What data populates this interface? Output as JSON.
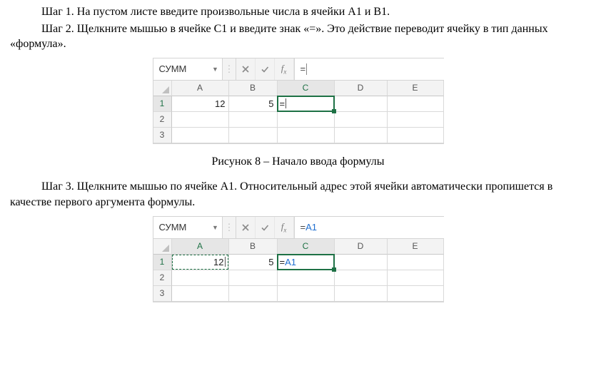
{
  "text": {
    "step1": "Шаг 1. На пустом листе введите произвольные числа в ячейки A1 и B1.",
    "step2": "Шаг 2. Щелкните мышью в ячейке C1 и введите знак «=». Это действие переводит ячейку в тип данных «формула».",
    "caption1": "Рисунок 8 – Начало ввода формулы",
    "step3": "Шаг 3. Щелкните мышью по ячейке A1. Относительный адрес этой ячейки автоматически пропишется в качестве первого аргумента формулы."
  },
  "shot1": {
    "name_box": "СУММ",
    "formula": "=",
    "columns": [
      "A",
      "B",
      "C",
      "D",
      "E"
    ],
    "rows": [
      "1",
      "2",
      "3"
    ],
    "a1": "12",
    "b1": "5",
    "c1": "="
  },
  "shot2": {
    "name_box": "СУММ",
    "formula_eq": "=",
    "formula_ref": "A1",
    "columns": [
      "A",
      "B",
      "C",
      "D",
      "E"
    ],
    "rows": [
      "1",
      "2",
      "3"
    ],
    "a1": "12",
    "b1": "5",
    "c1_eq": "=",
    "c1_ref": "A1"
  }
}
